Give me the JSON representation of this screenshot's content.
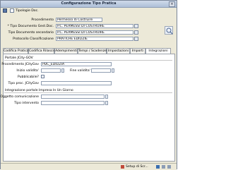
{
  "window": {
    "title": "Configurazione Tipo Pratica",
    "close_glyph": "×"
  },
  "toolbar": {
    "save_icon": "save-icon",
    "doc_icon": "document-icon",
    "tipologie_label": "Tipologie Doc."
  },
  "form": {
    "procedimento_label": "Procedimento",
    "procedimento_value": "Permesso di Costruire",
    "tipo_principale_label": "* Tipo Documento Gest.Doc.",
    "tipo_principale_value": "P.C. PERMESSI DI COSTRUIRE",
    "tipo_secondario_label": "Tipo Documento secondario",
    "tipo_secondario_value": "P.C. PERMESSI DI COSTRUIRE",
    "protocollo_label": "Protocollo Classificazione",
    "protocollo_value": "PRATICHE EDILIZIE"
  },
  "tabs": [
    {
      "label": "Codifica Pratica"
    },
    {
      "label": "Codifica Rilascio"
    },
    {
      "label": "Adempimenti"
    },
    {
      "label": "Tempi / Scadenze"
    },
    {
      "label": "Impostazioni"
    },
    {
      "label": "Importi"
    },
    {
      "label": "Integrazioni"
    }
  ],
  "integrazioni": {
    "portale_header": "Portale JCity-GOV",
    "procedimento_label": "Procedimento JCityGov",
    "procedimento_value": "PDC_EDILIZIA",
    "inizio_label": "Inizio validita'",
    "fine_label": "Fine validita'",
    "pubblicabile_label": "Pubblicabile?",
    "tipo_proc_label": "Tipo proc. JCityGov",
    "impresa_header": "Integrazione portale Impresa In Un Giorno",
    "oggetto_label": "Oggetto comunicazione",
    "tipo_intervento_label": "Tipo intervento"
  },
  "statusbar": {
    "setup": "Setup di Scr...",
    "icon1": "status-icon",
    "icon2": "status-icon"
  }
}
